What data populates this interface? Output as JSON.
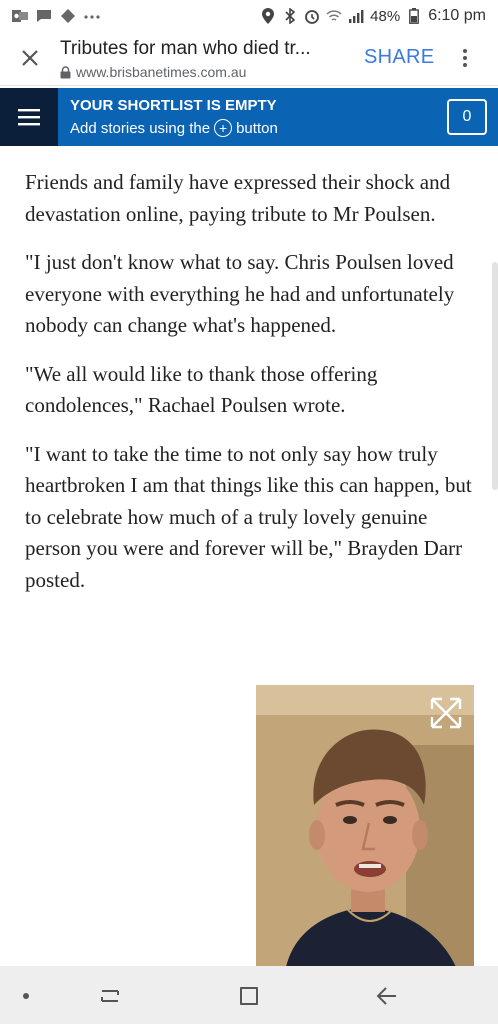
{
  "status_bar": {
    "battery": "48%",
    "time": "6:10 pm",
    "left_icons": [
      "outlook-icon",
      "message-icon",
      "navigation-icon",
      "more-dots-icon"
    ],
    "right_icons": [
      "location-icon",
      "bluetooth-icon",
      "alarm-icon",
      "wifi-icon",
      "signal-icon",
      "battery-icon"
    ]
  },
  "browser": {
    "title": "Tributes for man who died tr...",
    "url": "www.brisbanetimes.com.au",
    "share_label": "SHARE"
  },
  "shortlist": {
    "title": "YOUR SHORTLIST IS EMPTY",
    "subtitle_before": "Add stories using the",
    "subtitle_after": "button",
    "plus": "+",
    "count": "0",
    "color": "#0a63b3"
  },
  "article": {
    "paragraphs": [
      "Friends and family have expressed their shock and devastation online, paying tribute to Mr Poulsen.",
      "\"I just don't know what to say. Chris Poulsen loved everyone with everything he had and unfortunately nobody can change what's happened.",
      "\"We all would like to thank those offering condolences,\" Rachael Poulsen wrote.",
      "\"I want to take the time to not only say how truly heartbroken I am that things like this can happen, but to celebrate how much of a truly lovely genuine person you were and forever will be,\" Brayden Darr posted."
    ]
  },
  "video": {
    "icon": "expand-icon"
  },
  "nav_bar": {
    "items": [
      "nav-dot-icon",
      "recent-apps-icon",
      "home-icon",
      "back-icon"
    ]
  }
}
